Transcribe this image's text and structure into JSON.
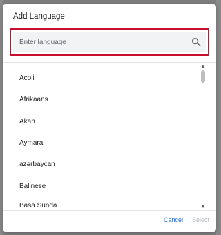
{
  "dialog": {
    "title": "Add Language"
  },
  "search": {
    "placeholder": "Enter language",
    "value": "",
    "highlight_color": "#c8102e",
    "icon": "search-icon"
  },
  "languages": [
    "Acoli",
    "Afrikaans",
    "Akan",
    "Aymara",
    "azərbaycan",
    "Balinese",
    "Basa Sunda"
  ],
  "footer": {
    "cancel_label": "Cancel",
    "select_label": "Select"
  },
  "colors": {
    "accent": "#1a73e8",
    "disabled": "#b8bcc1"
  }
}
